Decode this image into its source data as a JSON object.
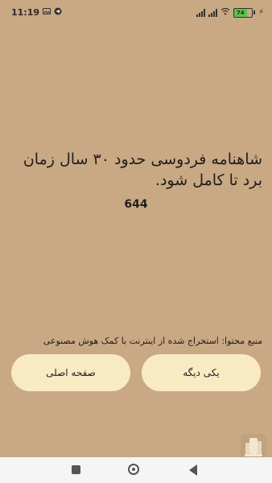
{
  "status_bar": {
    "time": "11:19",
    "battery_level": "74",
    "icons": [
      "photo-icon",
      "telegram-icon",
      "signal-icon",
      "wifi-icon",
      "battery-icon",
      "charging-icon"
    ]
  },
  "content": {
    "quote": "شاهنامه فردوسی حدود ۳۰ سال زمان برد تا کامل شود.",
    "number": "644",
    "source": "منبع محتوا: استخراج شده از اینترنت با کمک هوش مصنوعی"
  },
  "buttons": {
    "home_label": "صفحه اصلی",
    "next_label": "یکی دیگه"
  },
  "colors": {
    "background": "#c9a983",
    "button": "#f8ebc3"
  }
}
